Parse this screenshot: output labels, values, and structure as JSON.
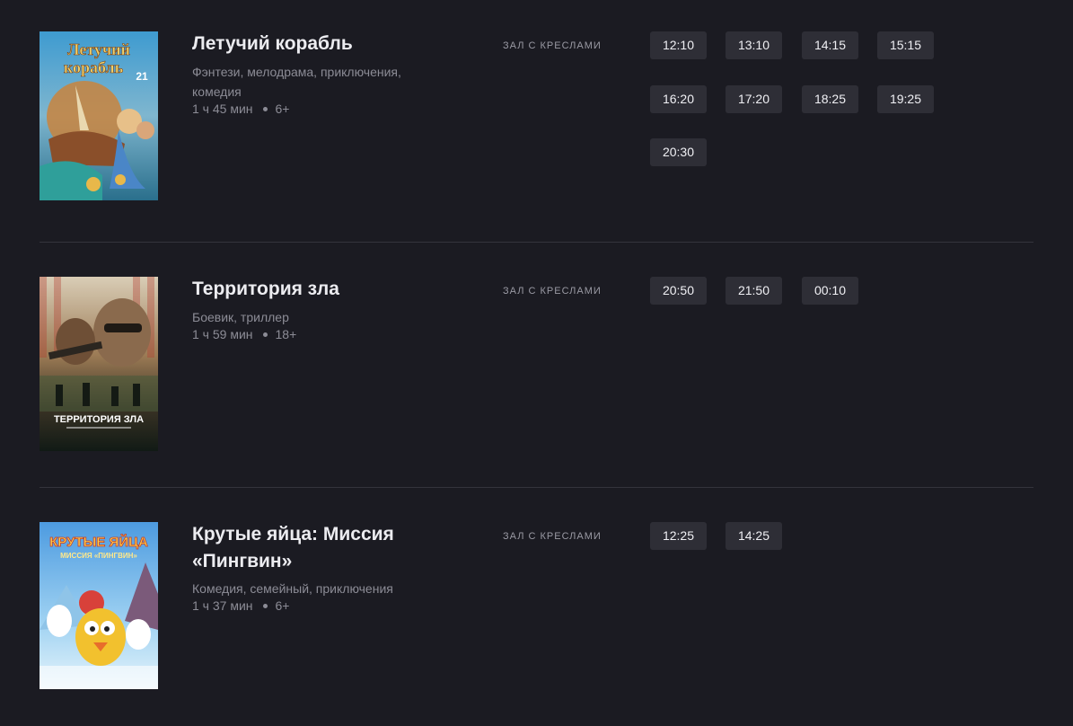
{
  "movies": [
    {
      "title": "Летучий корабль",
      "genres": "Фэнтези, мелодрама, приключения, комедия",
      "duration": "1 ч 45 мин",
      "age": "6+",
      "hall": "ЗАЛ С КРЕСЛАМИ",
      "times": [
        "12:10",
        "13:10",
        "14:15",
        "15:15",
        "16:20",
        "17:20",
        "18:25",
        "19:25",
        "20:30"
      ],
      "poster": {
        "title_text": "Летучий корабль",
        "date_text": "21",
        "colors": [
          "#2f86b8",
          "#c9843d",
          "#e2c16a"
        ]
      }
    },
    {
      "title": "Территория зла",
      "genres": "Боевик, триллер",
      "duration": "1 ч 59 мин",
      "age": "18+",
      "hall": "ЗАЛ С КРЕСЛАМИ",
      "times": [
        "20:50",
        "21:50",
        "00:10"
      ],
      "poster": {
        "title_text": "ТЕРРИТОРИЯ ЗЛА",
        "colors": [
          "#c6b8a2",
          "#7a5a3a",
          "#1c2a22"
        ]
      }
    },
    {
      "title": "Крутые яйца: Миссия «Пингвин»",
      "genres": "Комедия, семейный, приключения",
      "duration": "1 ч 37 мин",
      "age": "6+",
      "hall": "ЗАЛ С КРЕСЛАМИ",
      "times": [
        "12:25",
        "14:25"
      ],
      "poster": {
        "title_text": "КРУТЫЕ ЯЙЦА",
        "subtitle_text": "МИССИЯ «ПИНГВИН»",
        "colors": [
          "#5aa9e6",
          "#f2c12e",
          "#d8413a"
        ]
      }
    }
  ]
}
